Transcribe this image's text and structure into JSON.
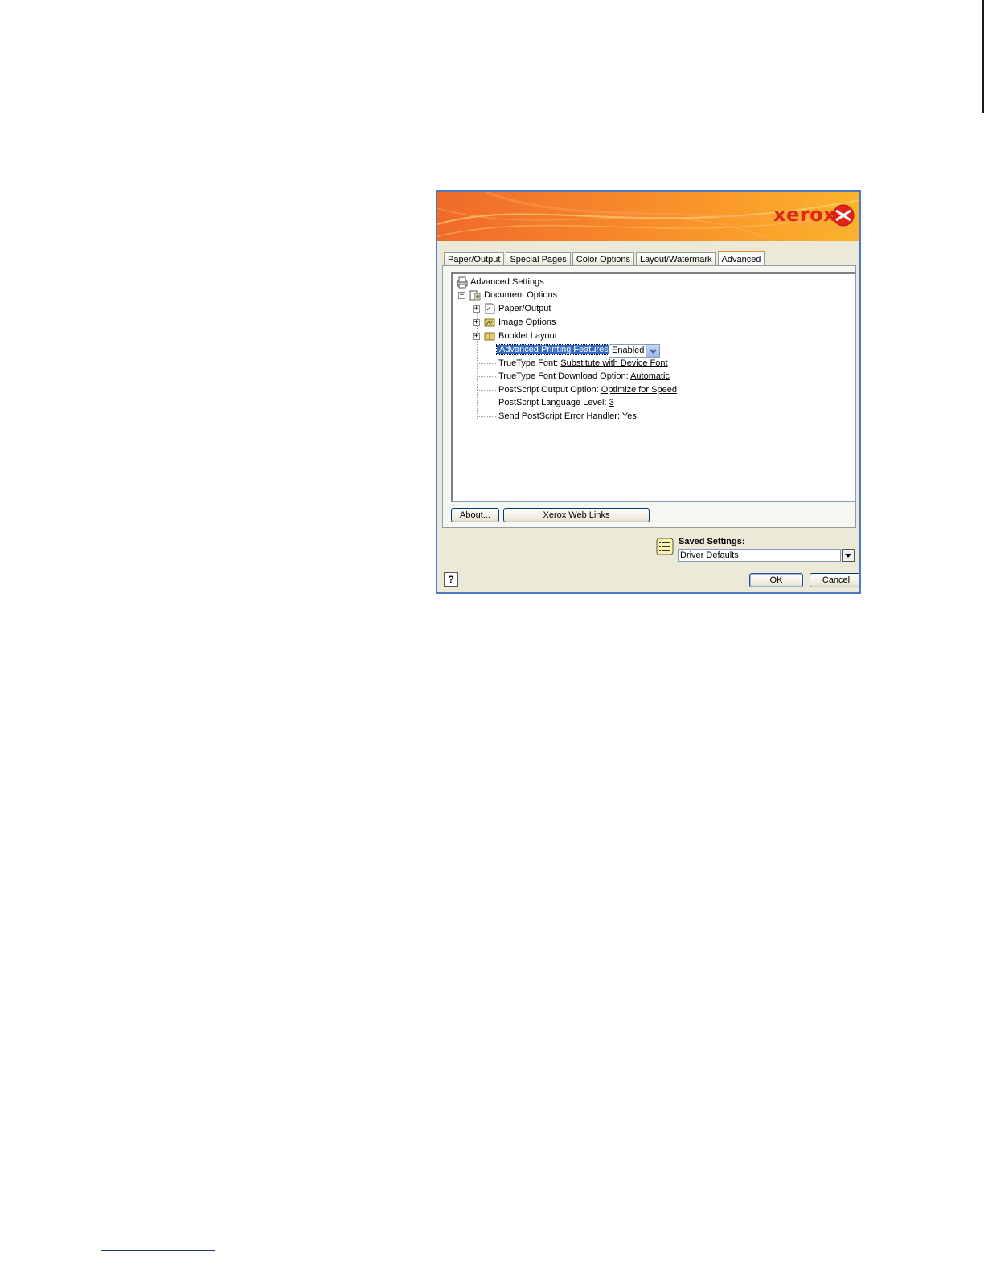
{
  "dialog": {
    "brand": "xerox",
    "tabs": [
      {
        "label": "Paper/Output"
      },
      {
        "label": "Special Pages"
      },
      {
        "label": "Color Options"
      },
      {
        "label": "Layout/Watermark"
      },
      {
        "label": "Advanced",
        "active": true
      }
    ],
    "tree": {
      "root": "Advanced Settings",
      "document_options": "Document Options",
      "paper_output": "Paper/Output",
      "image_options": "Image Options",
      "booklet_layout": "Booklet Layout",
      "advanced_printing_label": "Advanced Printing Features:",
      "advanced_printing_value": "Enabled",
      "truetype_font_label": "TrueType Font:",
      "truetype_font_value": "Substitute with Device Font",
      "truetype_download_label": "TrueType Font Download Option:",
      "truetype_download_value": "Automatic",
      "ps_output_label": "PostScript Output Option:",
      "ps_output_value": "Optimize for Speed",
      "ps_level_label": "PostScript Language Level:",
      "ps_level_value": "3",
      "ps_error_label": "Send PostScript Error Handler:",
      "ps_error_value": "Yes"
    },
    "buttons": {
      "about": "About...",
      "web_links": "Xerox Web Links",
      "ok": "OK",
      "cancel": "Cancel",
      "help": "?"
    },
    "saved_settings": {
      "label": "Saved Settings:",
      "value": "Driver Defaults"
    }
  },
  "colors": {
    "brand_red": "#e2231a",
    "selection": "#316ac5",
    "dialog_border": "#4a7bc4"
  }
}
